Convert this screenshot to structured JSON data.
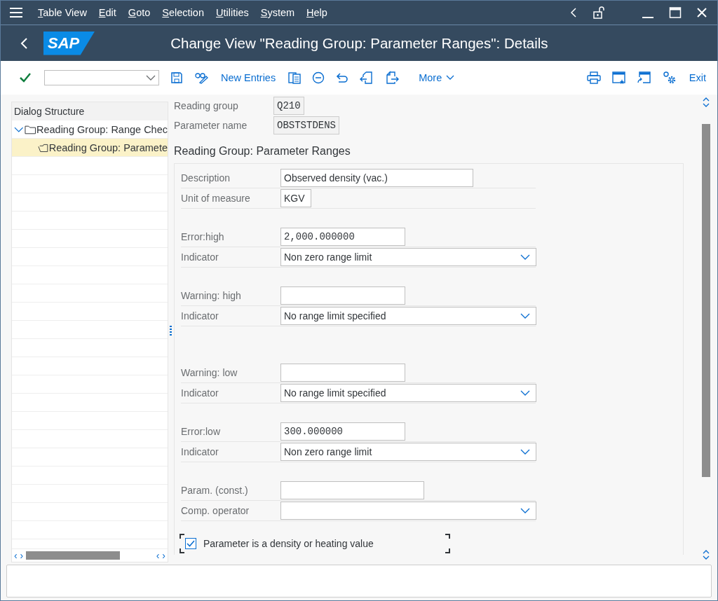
{
  "menu": [
    "Table View",
    "Edit",
    "Goto",
    "Selection",
    "Utilities",
    "System",
    "Help"
  ],
  "scroll_arrows": [
    "‹ ›",
    "‹ ›"
  ],
  "title": "Change View \"Reading Group: Parameter Ranges\": Details",
  "logo": "SAP",
  "toolbar": {
    "new_entries": "New Entries",
    "more": "More",
    "exit": "Exit"
  },
  "dialog_structure": {
    "title": "Dialog Structure",
    "tree": [
      {
        "label": "Reading Group: Range Chec",
        "expanded": true,
        "selected": false,
        "children": [
          {
            "label": "Reading Group: Paramete",
            "selected": true
          }
        ]
      }
    ]
  },
  "header_fields": [
    {
      "label": "Reading group",
      "value": "Q210"
    },
    {
      "label": "Parameter name",
      "value": "OBSTSTDENS"
    }
  ],
  "section_title": "Reading Group: Parameter Ranges",
  "groups": [
    [
      {
        "label": "Description",
        "kind": "text",
        "value": "Observed density (vac.)"
      },
      {
        "label": "Unit of measure",
        "kind": "unit",
        "value": "KGV"
      }
    ],
    [
      {
        "label": "Error:high",
        "kind": "number",
        "value": "2,000.000000"
      },
      {
        "label": "Indicator",
        "kind": "dropdown",
        "value": "Non zero range limit"
      }
    ],
    [
      {
        "label": "Warning: high",
        "kind": "number"
      },
      {
        "label": "Indicator",
        "kind": "dropdown",
        "value": "No range limit specified"
      }
    ],
    [
      {
        "label": "Warning: low",
        "kind": "number"
      },
      {
        "label": "Indicator",
        "kind": "dropdown",
        "value": "No range limit specified"
      }
    ],
    [
      {
        "label": "Error:low",
        "kind": "number",
        "value": "300.000000"
      },
      {
        "label": "Indicator",
        "kind": "dropdown",
        "value": "Non zero range limit"
      }
    ],
    [
      {
        "label": "Param. (const.)",
        "kind": "wide"
      },
      {
        "label": "Comp. operator",
        "kind": "dropdown"
      }
    ]
  ],
  "checkbox": {
    "label": "Parameter is a density or heating value",
    "checked": true
  }
}
